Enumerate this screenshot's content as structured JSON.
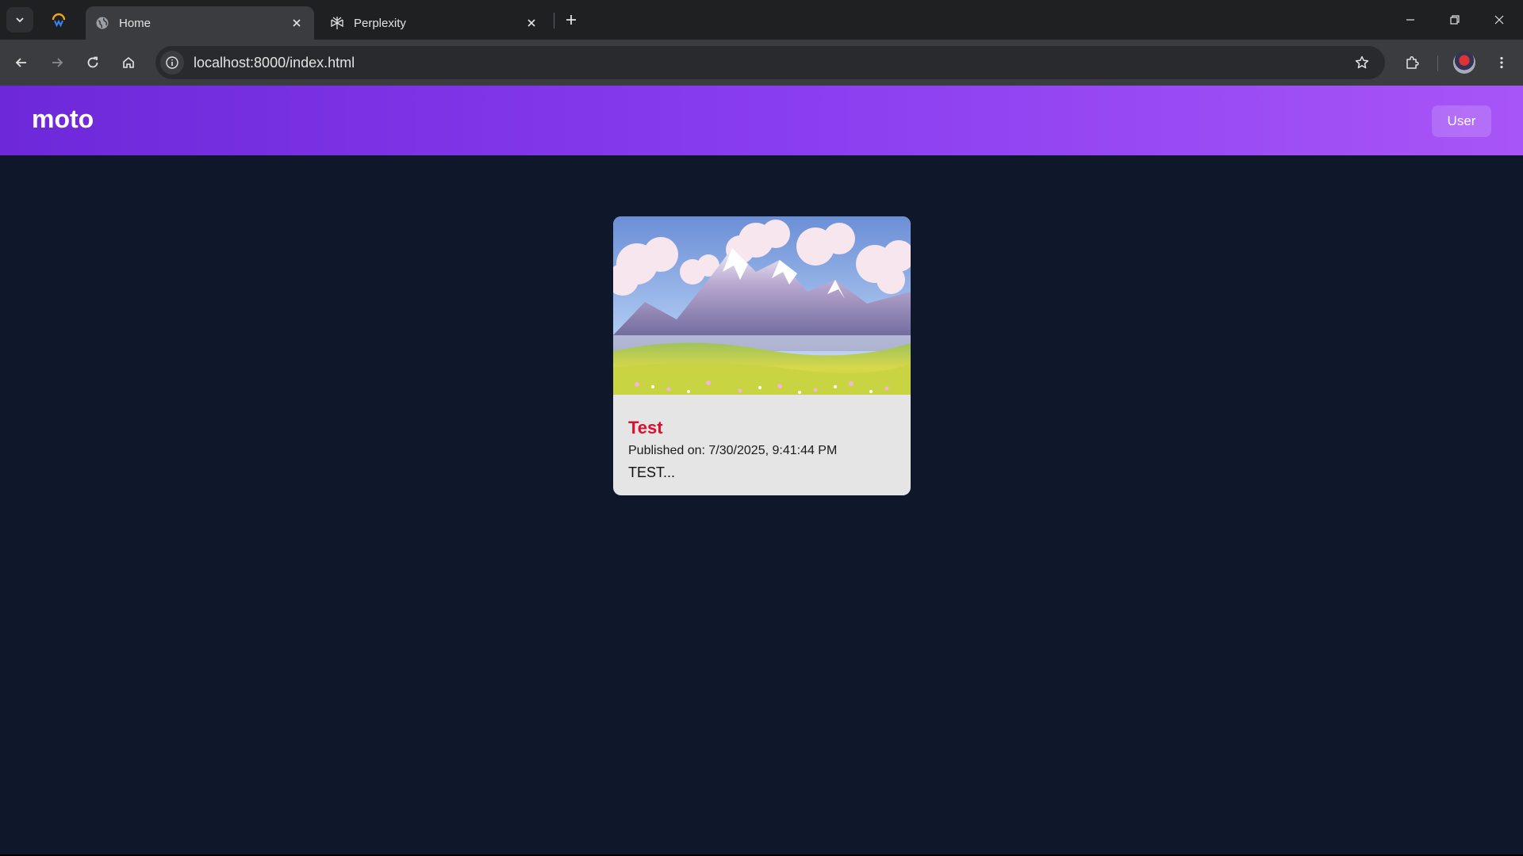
{
  "browser": {
    "tabs": [
      {
        "label": "Home",
        "active": true,
        "icon": "globe-icon"
      },
      {
        "label": "Perplexity",
        "active": false,
        "icon": "perplexity-icon"
      }
    ],
    "address_bar": {
      "url": "localhost:8000/index.html"
    }
  },
  "app": {
    "brand": "moto",
    "user_button": "User"
  },
  "posts": [
    {
      "title": "Test",
      "published": "Published on: 7/30/2025, 9:41:44 PM",
      "excerpt": "TEST...",
      "image": "mountain-landscape-image"
    }
  ],
  "colors": {
    "header_start": "#6d28d9",
    "header_end": "#a855f7",
    "page_bg": "#0f172a",
    "card_bg": "#e5e5e5",
    "post_title": "#dc0f2e"
  }
}
